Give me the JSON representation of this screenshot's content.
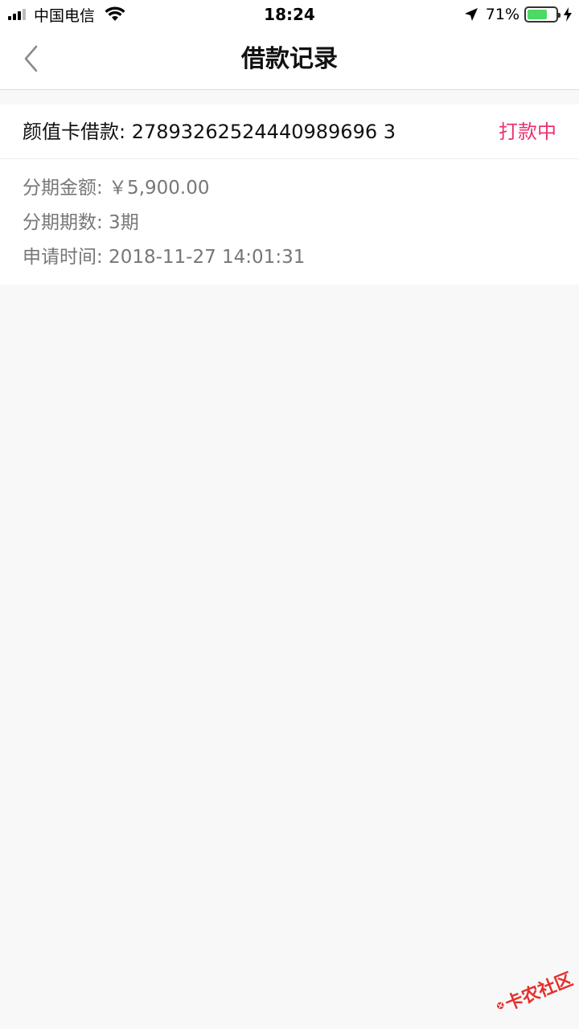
{
  "status_bar": {
    "carrier": "中国电信",
    "time": "18:24",
    "battery_percent": "71%",
    "battery_level": 0.71,
    "icons": [
      "signal-icon",
      "wifi-icon",
      "location-icon",
      "battery-icon",
      "charging-icon"
    ]
  },
  "nav": {
    "title": "借款记录",
    "back_icon": "chevron-left-icon"
  },
  "record": {
    "heading": "颜值卡借款: 27893262524440989696 3",
    "status": "打款中",
    "status_color": "#e8336c",
    "details": [
      "分期金额: ￥5,900.00",
      "分期期数: 3期",
      "申请时间: 2018-11-27 14:01:31"
    ]
  },
  "watermark": {
    "text": "卡农社区",
    "color": "#e4302b"
  }
}
